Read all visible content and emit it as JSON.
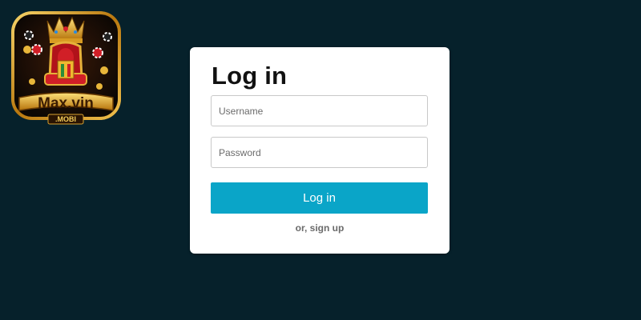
{
  "logo": {
    "brand_text": "Max.vin",
    "sub_text": ".MOBI"
  },
  "login": {
    "title": "Log in",
    "username_placeholder": "Username",
    "password_placeholder": "Password",
    "submit_label": "Log in",
    "signup_link": "or, sign up"
  },
  "colors": {
    "background": "#06212b",
    "card": "#ffffff",
    "primary_button": "#0aa5c8",
    "link_text": "#6a6a6a"
  }
}
